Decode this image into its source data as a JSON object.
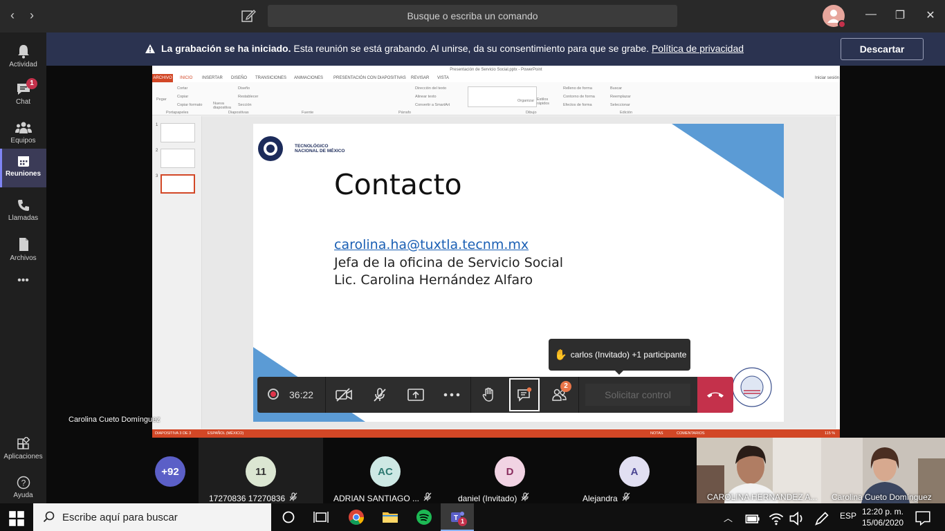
{
  "titlebar": {
    "search_placeholder": "Busque o escriba un comando"
  },
  "rail": {
    "items": [
      {
        "label": "Actividad",
        "icon": "bell-icon"
      },
      {
        "label": "Chat",
        "icon": "chat-icon",
        "badge": "1"
      },
      {
        "label": "Equipos",
        "icon": "teams-icon"
      },
      {
        "label": "Reuniones",
        "icon": "calendar-icon",
        "active": true
      },
      {
        "label": "Llamadas",
        "icon": "phone-icon"
      },
      {
        "label": "Archivos",
        "icon": "file-icon"
      }
    ],
    "more": "•••",
    "apps_label": "Aplicaciones",
    "help_label": "Ayuda"
  },
  "banner": {
    "bold": "La grabación se ha iniciado.",
    "text": " Esta reunión se está grabando. Al unirse, da su consentimiento para que se grabe. ",
    "link": "Política de privacidad",
    "dismiss": "Descartar"
  },
  "ppt": {
    "window_title": "Presentación de Servicio Social.pptx - PowerPoint",
    "file_tab": "ARCHIVO",
    "tabs": [
      "INICIO",
      "INSERTAR",
      "DISEÑO",
      "TRANSICIONES",
      "ANIMACIONES",
      "PRESENTACIÓN CON DIAPOSITIVAS",
      "REVISAR",
      "VISTA"
    ],
    "signin": "Iniciar sesión",
    "ribbon_groups": [
      "Portapapeles",
      "Diapositivas",
      "Fuente",
      "Párrafo",
      "Dibujo",
      "Edición"
    ],
    "ribbon_items": {
      "paste": "Pegar",
      "new_slide": "Nueva diapositiva",
      "design": "Diseño",
      "reset": "Restablecer",
      "section": "Sección",
      "cut": "Cortar",
      "copy": "Copiar",
      "format_painter": "Copiar formato",
      "text_direction": "Dirección del texto",
      "align_text": "Alinear texto",
      "smartart": "Convertir a SmartArt",
      "arrange": "Organizar",
      "quick_styles": "Estilos rápidos",
      "shape_fill": "Relleno de forma",
      "shape_outline": "Contorno de forma",
      "shape_effects": "Efectos de forma",
      "find": "Buscar",
      "replace": "Reemplazar",
      "select": "Seleccionar"
    },
    "thumb_numbers": [
      "1",
      "2",
      "3"
    ],
    "status_left": "DIAPOSITIVA 3 DE 3",
    "status_lang": "ESPAÑOL (MÉXICO)",
    "status_notes": "NOTAS",
    "status_comments": "COMENTARIOS",
    "zoom": "115 %"
  },
  "slide": {
    "logo_text_1": "TECNOLÓGICO",
    "logo_text_2": "NACIONAL DE MÉXICO",
    "title": "Contacto",
    "email": "carolina.ha@tuxtla.tecnm.mx",
    "line1": "Jefa de la oficina de Servicio Social",
    "line2": "Lic. Carolina Hernández Alfaro",
    "accent_color": "#5b9bd5"
  },
  "presenter_name": "Carolina Cueto Domínguez",
  "controls": {
    "timer": "36:22",
    "people_count": "2",
    "request_control": "Solicitar control"
  },
  "tooltip": {
    "icon": "raised-hand-icon",
    "text": "carlos (Invitado) +1 participante"
  },
  "participants": [
    {
      "initials": "+92",
      "name": "",
      "bg": "#5b5fc7",
      "fg": "#ffffff"
    },
    {
      "initials": "11",
      "name": "17270836 17270836",
      "bg": "#dbe6d2",
      "fg": "#333333"
    },
    {
      "initials": "AC",
      "name": "ADRIAN SANTIAGO ...",
      "bg": "#cde8e4",
      "fg": "#2e7a72"
    },
    {
      "initials": "D",
      "name": "daniel (Invitado)",
      "bg": "#f1d3e3",
      "fg": "#8a2d5e"
    },
    {
      "initials": "A",
      "name": "Alejandra",
      "bg": "#e1dff2",
      "fg": "#4a4592"
    },
    {
      "initials": "",
      "name": "CAROLINA HERNANDEZ A...",
      "video": true
    },
    {
      "initials": "",
      "name": "Carolina Cueto Domínguez",
      "video": true
    }
  ],
  "taskbar": {
    "search_placeholder": "Escribe aquí para buscar",
    "lang": "ESP",
    "time": "12:20 p. m.",
    "date": "15/06/2020",
    "teams_badge": "1"
  }
}
